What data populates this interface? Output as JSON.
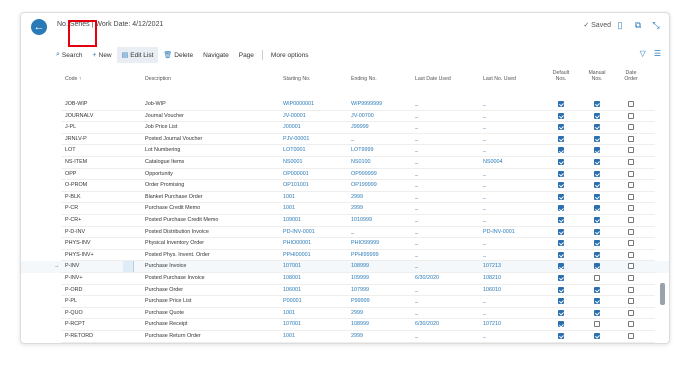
{
  "header": {
    "title": "No. Series | Work Date: 4/12/2021",
    "saved": "Saved"
  },
  "actions": {
    "search": "Search",
    "new": "New",
    "edit_list": "Edit List",
    "delete": "Delete",
    "navigate": "Navigate",
    "page": "Page",
    "more_options": "More options"
  },
  "columns": {
    "code": "Code ↑",
    "description": "Description",
    "starting": "Starting No.",
    "ending": "Ending No.",
    "last_date": "Last Date Used",
    "last_no": "Last No. Used",
    "default_l1": "Default",
    "default_l2": "Nos.",
    "manual_l1": "Manual",
    "manual_l2": "Nos.",
    "date_l1": "Date",
    "date_l2": "Order"
  },
  "rows": [
    {
      "code": "JOB-WIP",
      "desc": "Job-WIP",
      "start": "WIP0000001",
      "end": "WIP9999999",
      "ldate": "_",
      "lno": "_",
      "def": true,
      "man": true,
      "ord": false
    },
    {
      "code": "JOURNALV",
      "desc": "Journal Voucher",
      "start": "JV-00001",
      "end": "JV-00700",
      "ldate": "_",
      "lno": "_",
      "def": true,
      "man": true,
      "ord": false
    },
    {
      "code": "J-PL",
      "desc": "Job Price List",
      "start": "J00001",
      "end": "J99999",
      "ldate": "_",
      "lno": "_",
      "def": true,
      "man": true,
      "ord": false
    },
    {
      "code": "JRNLV-P",
      "desc": "Posted Journal Voucher",
      "start": "PJV-00001",
      "end": "_",
      "ldate": "_",
      "lno": "_",
      "def": true,
      "man": true,
      "ord": false
    },
    {
      "code": "LOT",
      "desc": "Lot Numbering",
      "start": "LOT0001",
      "end": "LOT9999",
      "ldate": "_",
      "lno": "_",
      "def": true,
      "man": true,
      "ord": false
    },
    {
      "code": "NS-ITEM",
      "desc": "Catalogue Items",
      "start": "NS0001",
      "end": "NS0100",
      "ldate": "_",
      "lno": "NS0004",
      "def": true,
      "man": true,
      "ord": false
    },
    {
      "code": "OPP",
      "desc": "Opportunity",
      "start": "OP000001",
      "end": "OP999999",
      "ldate": "_",
      "lno": "_",
      "def": true,
      "man": true,
      "ord": false
    },
    {
      "code": "O-PROM",
      "desc": "Order Promising",
      "start": "OP101001",
      "end": "OP199999",
      "ldate": "_",
      "lno": "_",
      "def": true,
      "man": true,
      "ord": false
    },
    {
      "code": "P-BLK",
      "desc": "Blanket Purchase Order",
      "start": "1001",
      "end": "2999",
      "ldate": "_",
      "lno": "_",
      "def": true,
      "man": true,
      "ord": false
    },
    {
      "code": "P-CR",
      "desc": "Purchase Credit Memo",
      "start": "1001",
      "end": "2999",
      "ldate": "_",
      "lno": "_",
      "def": true,
      "man": true,
      "ord": false
    },
    {
      "code": "P-CR+",
      "desc": "Posted Purchase Credit Memo",
      "start": "109001",
      "end": "1010999",
      "ldate": "_",
      "lno": "_",
      "def": true,
      "man": true,
      "ord": false
    },
    {
      "code": "P-D-INV",
      "desc": "Posted Distribution Invoice",
      "start": "PD-INV-0001",
      "end": "_",
      "ldate": "_",
      "lno": "PD-INV-0001",
      "def": true,
      "man": true,
      "ord": false
    },
    {
      "code": "PHYS-INV",
      "desc": "Physical Inventory Order",
      "start": "PHIO00001",
      "end": "PHIO99999",
      "ldate": "_",
      "lno": "_",
      "def": true,
      "man": true,
      "ord": false
    },
    {
      "code": "PHYS-INV+",
      "desc": "Posted Phys. Invent. Order",
      "start": "PPHI00001",
      "end": "PPHI99999",
      "ldate": "_",
      "lno": "_",
      "def": true,
      "man": true,
      "ord": false
    },
    {
      "code": "P-INV",
      "desc": "Purchase Invoice",
      "start": "107001",
      "end": "108999",
      "ldate": "_",
      "lno": "107213",
      "def": true,
      "man": true,
      "ord": false,
      "selected": true
    },
    {
      "code": "P-INV+",
      "desc": "Posted Purchase Invoice",
      "start": "108001",
      "end": "109999",
      "ldate": "6/30/2020",
      "lno": "108210",
      "def": true,
      "man": false,
      "ord": false
    },
    {
      "code": "P-ORD",
      "desc": "Purchase Order",
      "start": "106001",
      "end": "107999",
      "ldate": "_",
      "lno": "106010",
      "def": true,
      "man": true,
      "ord": false
    },
    {
      "code": "P-PL",
      "desc": "Purchase Price List",
      "start": "P00001",
      "end": "P99999",
      "ldate": "_",
      "lno": "_",
      "def": true,
      "man": true,
      "ord": false
    },
    {
      "code": "P-QUO",
      "desc": "Purchase Quote",
      "start": "1001",
      "end": "2999",
      "ldate": "_",
      "lno": "_",
      "def": true,
      "man": true,
      "ord": false
    },
    {
      "code": "P-RCPT",
      "desc": "Purchase Receipt",
      "start": "107001",
      "end": "108999",
      "ldate": "6/30/2020",
      "lno": "107210",
      "def": true,
      "man": false,
      "ord": false
    },
    {
      "code": "P-RETORD",
      "desc": "Purchase Return Order",
      "start": "1001",
      "end": "2999",
      "ldate": "_",
      "lno": "_",
      "def": true,
      "man": true,
      "ord": false
    }
  ]
}
